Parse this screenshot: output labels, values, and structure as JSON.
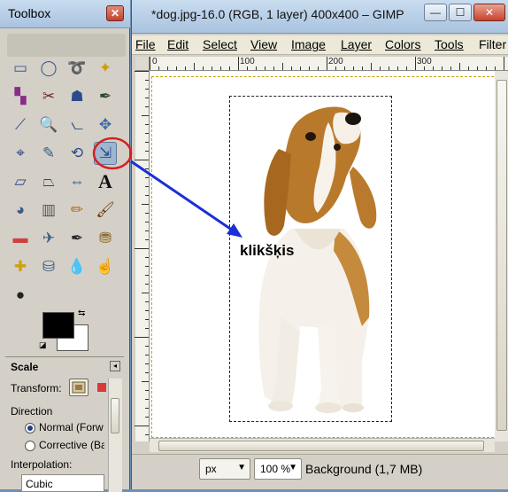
{
  "toolbox": {
    "title": "Toolbox",
    "close_label": "✕",
    "tools": [
      {
        "name": "rect-select-icon",
        "glyph": "▭"
      },
      {
        "name": "ellipse-select-icon",
        "glyph": "◯"
      },
      {
        "name": "free-select-icon",
        "glyph": "➰"
      },
      {
        "name": "fuzzy-select-icon",
        "glyph": "✦"
      },
      {
        "name": "color-select-icon",
        "glyph": "▚"
      },
      {
        "name": "scissors-icon",
        "glyph": "✂"
      },
      {
        "name": "foreground-select-icon",
        "glyph": "☗"
      },
      {
        "name": "paths-icon",
        "glyph": "✒"
      },
      {
        "name": "color-picker-icon",
        "glyph": "⟋"
      },
      {
        "name": "zoom-icon",
        "glyph": "🔍"
      },
      {
        "name": "measure-icon",
        "glyph": "⦦"
      },
      {
        "name": "move-icon",
        "glyph": "✥"
      },
      {
        "name": "align-icon",
        "glyph": "⌖"
      },
      {
        "name": "crop-icon",
        "glyph": "✎"
      },
      {
        "name": "rotate-icon",
        "glyph": "⟲"
      },
      {
        "name": "scale-icon",
        "glyph": "⇲"
      },
      {
        "name": "shear-icon",
        "glyph": "▱"
      },
      {
        "name": "perspective-icon",
        "glyph": "⏢"
      },
      {
        "name": "flip-icon",
        "glyph": "⇔"
      },
      {
        "name": "text-icon",
        "glyph": "A"
      },
      {
        "name": "bucket-fill-icon",
        "glyph": "◕"
      },
      {
        "name": "blend-icon",
        "glyph": "▥"
      },
      {
        "name": "pencil-icon",
        "glyph": "✏"
      },
      {
        "name": "paintbrush-icon",
        "glyph": "🖌"
      },
      {
        "name": "eraser-icon",
        "glyph": "▬"
      },
      {
        "name": "airbrush-icon",
        "glyph": "✈"
      },
      {
        "name": "ink-icon",
        "glyph": "✒"
      },
      {
        "name": "clone-icon",
        "glyph": "⛃"
      },
      {
        "name": "heal-icon",
        "glyph": "✚"
      },
      {
        "name": "perspective-clone-icon",
        "glyph": "⛁"
      },
      {
        "name": "blur-icon",
        "glyph": "💧"
      },
      {
        "name": "smudge-icon",
        "glyph": "☝"
      },
      {
        "name": "dodge-burn-icon",
        "glyph": "●"
      }
    ],
    "options": {
      "title": "Scale",
      "transform_label": "Transform:",
      "direction_label": "Direction",
      "direction_options": [
        "Normal (Forw",
        "Corrective (Ba"
      ],
      "interpolation_label": "Interpolation:",
      "interpolation_value": "Cubic"
    }
  },
  "image_window": {
    "title": "*dog.jpg-16.0 (RGB, 1 layer) 400x400 – GIMP",
    "window_buttons": [
      "—",
      "☐",
      "✕"
    ],
    "menu": [
      "File",
      "Edit",
      "Select",
      "View",
      "Image",
      "Layer",
      "Colors",
      "Tools",
      "Filter"
    ],
    "menu_underline_index": [
      0,
      0,
      0,
      0,
      0,
      0,
      0,
      0,
      3
    ],
    "ruler_labels": [
      "0",
      "100",
      "200",
      "300"
    ],
    "unit": "px",
    "zoom": "100 %",
    "status": "Background (1,7 MB)"
  },
  "annotation": {
    "label": "klikšķis",
    "circle_color": "#d42020",
    "arrow_color": "#1a2fd6"
  }
}
